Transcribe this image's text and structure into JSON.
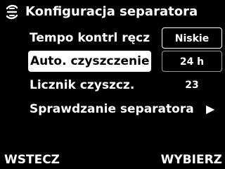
{
  "header": {
    "title": "Konfiguracja separatora",
    "icon": "separator-icon"
  },
  "menu": {
    "items": [
      {
        "label": "Tempo kontrl ręcz",
        "value": "Niskie",
        "selected": false
      },
      {
        "label": "Auto. czyszczenie",
        "value": "24 h",
        "selected": true
      },
      {
        "label": "Licznik czyszcz.",
        "value": "23",
        "selected": false
      },
      {
        "label": "Sprawdzanie separatora",
        "value": "",
        "arrow": "▶",
        "selected": false
      }
    ]
  },
  "footer": {
    "back_label": "WSTECZ",
    "select_label": "WYBIERZ"
  },
  "colors": {
    "background": "#000000",
    "text": "#ffffff",
    "highlight": "#ffffff"
  }
}
